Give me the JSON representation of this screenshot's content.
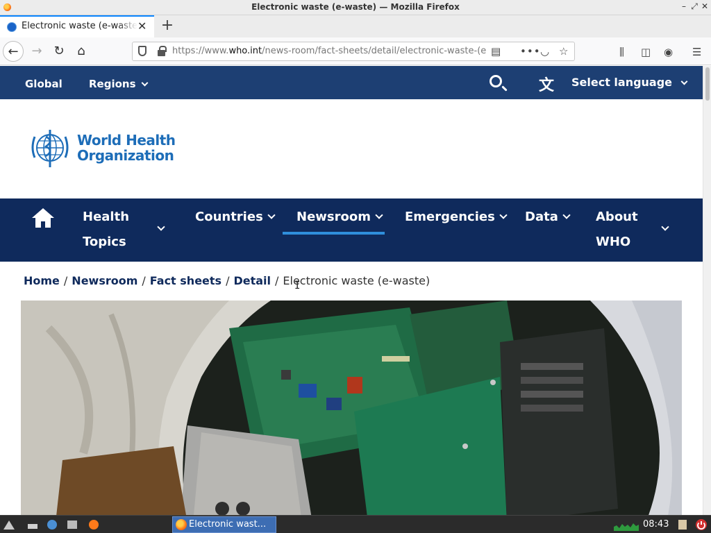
{
  "window": {
    "title": "Electronic waste (e-waste) — Mozilla Firefox"
  },
  "tabs": [
    {
      "title": "Electronic waste (e-waste)",
      "active": true
    }
  ],
  "toolbar": {
    "url_prefix": "https://www.",
    "url_domain": "who.int",
    "url_path": "/news-room/fact-sheets/detail/electronic-waste-(e-waste)"
  },
  "site": {
    "top_links": {
      "global": "Global",
      "regions": "Regions"
    },
    "language_label": "Select language",
    "logo": {
      "line1": "World Health",
      "line2": "Organization"
    },
    "nav": [
      {
        "line1": "Health",
        "line2": "Topics",
        "has_dropdown": true
      },
      {
        "line1": "Countries",
        "has_dropdown": true
      },
      {
        "line1": "Newsroom",
        "has_dropdown": true,
        "active": true
      },
      {
        "line1": "Emergencies",
        "has_dropdown": true
      },
      {
        "line1": "Data",
        "has_dropdown": true
      },
      {
        "line1": "About",
        "line2": "WHO",
        "has_dropdown": true
      }
    ],
    "breadcrumb": {
      "items": [
        "Home",
        "Newsroom",
        "Fact sheets",
        "Detail"
      ],
      "current": "Electronic waste (e-waste)"
    }
  },
  "taskbar": {
    "window_label": "Electronic wast...",
    "clock": "08:43"
  },
  "colors": {
    "top_band": "#1d3f73",
    "main_nav": "#0f2a5c",
    "active_underline": "#2f8fdc",
    "who_blue": "#1d6db8"
  }
}
